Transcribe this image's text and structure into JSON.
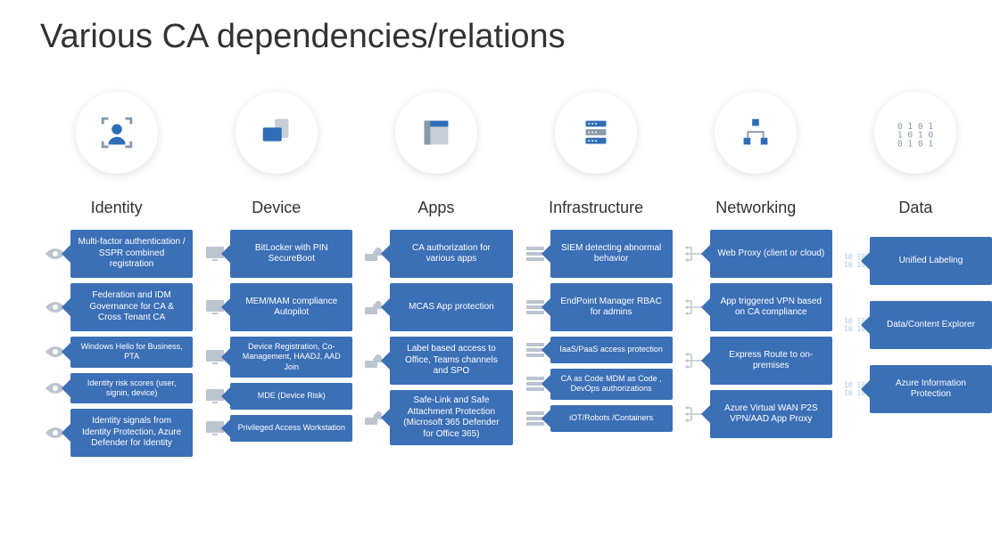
{
  "title": "Various CA dependencies/relations",
  "columns": {
    "identity": {
      "header": "Identity",
      "items": [
        "Multi-factor authentication / SSPR combined registration",
        "Federation and IDM Governance for CA & Cross Tenant CA",
        "Windows Hello for Business, PTA",
        "Identity risk scores (user, signin, device)",
        "Identity signals from Identity Protection, Azure Defender for Identity"
      ]
    },
    "device": {
      "header": "Device",
      "items": [
        "BitLocker with PIN SecureBoot",
        "MEM/MAM compliance Autopilot",
        "Device Registration, Co-Management, HAADJ, AAD Join",
        "MDE (Device Risk)",
        "Privileged Access Workstation"
      ]
    },
    "apps": {
      "header": "Apps",
      "items": [
        "CA authorization for various apps",
        "MCAS App protection",
        "Label based access to Office, Teams channels and SPO",
        "Safe-Link and Safe Attachment Protection (Microsoft 365 Defender for Office 365)"
      ]
    },
    "infra": {
      "header": "Infrastructure",
      "items": [
        "SIEM detecting abnormal behavior",
        "EndPoint Manager RBAC for admins",
        "IaaS/PaaS access protection",
        "CA as Code MDM as Code , DevOps authorizations",
        "iOT/Robots /Containers"
      ]
    },
    "net": {
      "header": "Networking",
      "items": [
        "Web Proxy (client or cloud)",
        "App triggered VPN based on CA compliance",
        "Express Route to on-premises",
        "Azure Virtual WAN P2S VPN/AAD App Proxy"
      ]
    },
    "data": {
      "header": "Data",
      "items": [
        "Unified Labeling",
        "Data/Content Explorer",
        "Azure Information Protection"
      ]
    }
  }
}
